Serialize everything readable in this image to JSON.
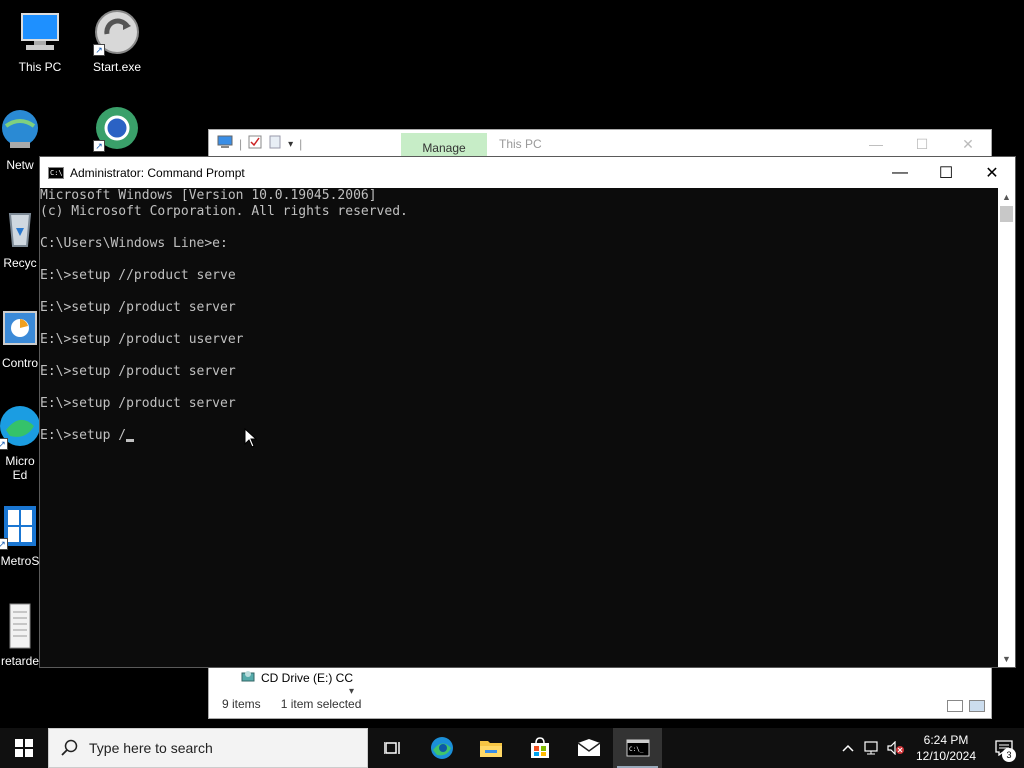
{
  "desktop": {
    "icons": [
      {
        "label": "This PC",
        "icon": "computer-icon"
      },
      {
        "label": "Start.exe",
        "icon": "start-exe-icon"
      },
      {
        "label": "Netw",
        "icon": "network-icon"
      },
      {
        "label": "",
        "icon": "browser-icon"
      },
      {
        "label": "Recyc",
        "icon": "recycle-bin-icon"
      },
      {
        "label": "Contro",
        "icon": "control-panel-icon"
      },
      {
        "label": "Micro\nEd",
        "icon": "edge-icon"
      },
      {
        "label": "MetroS",
        "icon": "metro-icon"
      },
      {
        "label": "retarde",
        "icon": "document-icon"
      }
    ]
  },
  "explorer": {
    "manage_tab": "Manage",
    "title": "This PC",
    "nav_item": "CD Drive (E:) CC",
    "status_items": "9 items",
    "status_selected": "1 item selected"
  },
  "cmd": {
    "title": "Administrator: Command Prompt",
    "lines": [
      "Microsoft Windows [Version 10.0.19045.2006]",
      "(c) Microsoft Corporation. All rights reserved.",
      "",
      "C:\\Users\\Windows Line>e:",
      "",
      "E:\\>setup //product serve",
      "",
      "E:\\>setup /product server",
      "",
      "E:\\>setup /product userver",
      "",
      "E:\\>setup /product server",
      "",
      "E:\\>setup /product server",
      "",
      "E:\\>setup /"
    ]
  },
  "taskbar": {
    "search_placeholder": "Type here to search",
    "time": "6:24 PM",
    "date": "12/10/2024",
    "notification_count": "3"
  },
  "colors": {
    "console_bg": "#0c0c0c",
    "console_fg": "#c0c0c0",
    "manage_tab": "#c7edc7",
    "taskbar": "#101010"
  }
}
